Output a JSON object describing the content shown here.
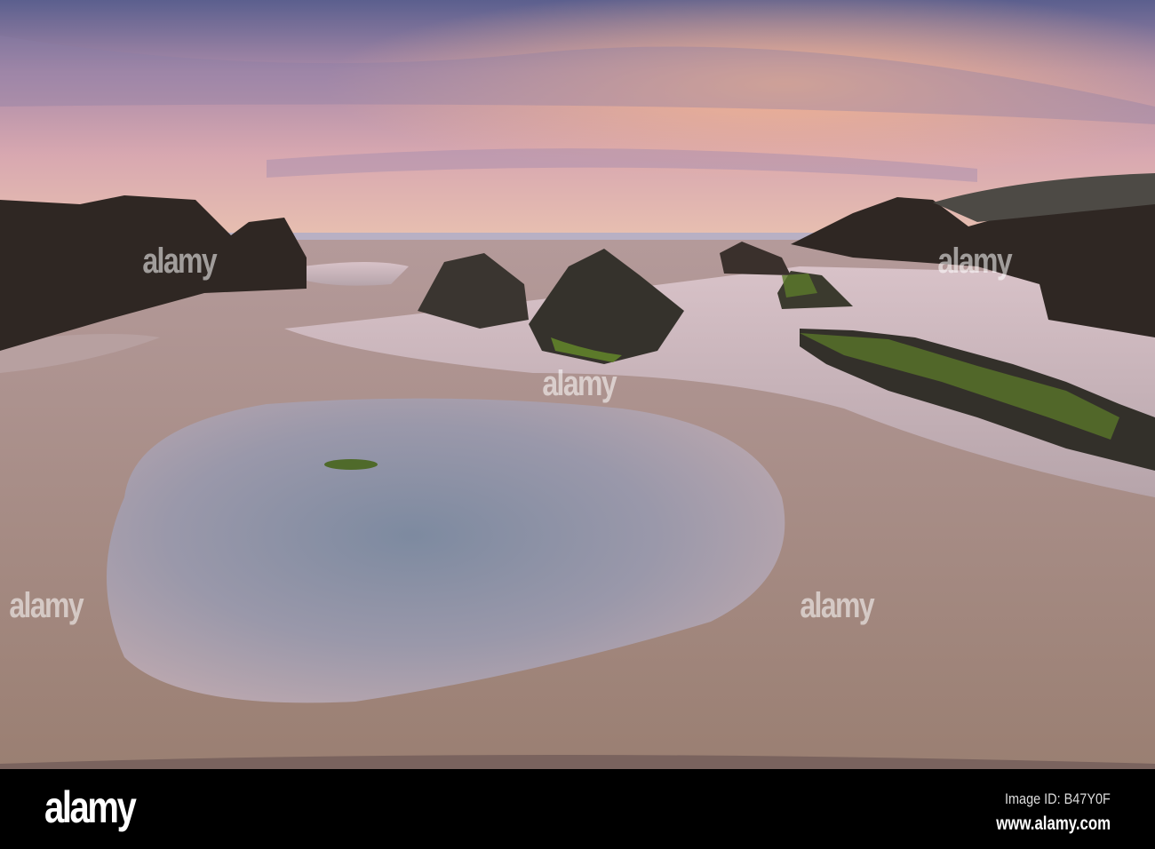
{
  "photo": {
    "subject": "Sunset over beach rock pools",
    "watermark_text": "alamy"
  },
  "footer": {
    "logo": "alamy",
    "image_id": "Image ID: B47Y0F",
    "website": "www.alamy.com"
  },
  "colors": {
    "sky_top": "#5a5d8c",
    "sky_glow": "#f0a58a",
    "sand": "#9e857c",
    "rock": "#2e2824",
    "moss": "#5c7a2a"
  }
}
